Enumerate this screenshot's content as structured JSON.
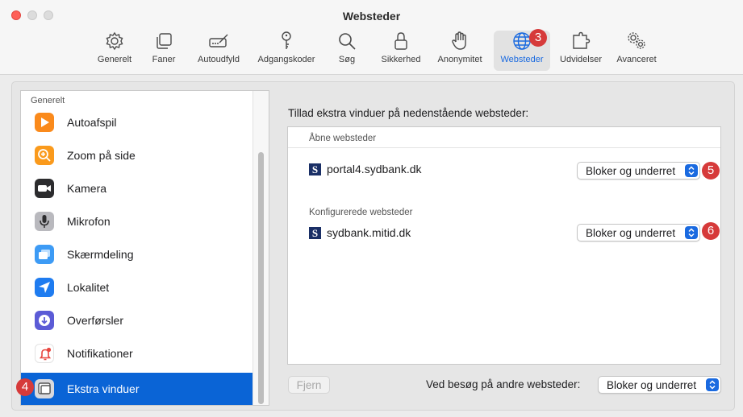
{
  "window": {
    "title": "Websteder"
  },
  "toolbar": {
    "items": [
      {
        "label": "Generelt",
        "icon": "gear-icon"
      },
      {
        "label": "Faner",
        "icon": "tabs-icon"
      },
      {
        "label": "Autoudfyld",
        "icon": "autofill-icon"
      },
      {
        "label": "Adgangskoder",
        "icon": "key-icon"
      },
      {
        "label": "Søg",
        "icon": "search-icon"
      },
      {
        "label": "Sikkerhed",
        "icon": "lock-icon"
      },
      {
        "label": "Anonymitet",
        "icon": "hand-icon"
      },
      {
        "label": "Websteder",
        "icon": "globe-icon",
        "active": true
      },
      {
        "label": "Udvidelser",
        "icon": "puzzle-icon"
      },
      {
        "label": "Avanceret",
        "icon": "gears-icon"
      }
    ]
  },
  "markers": {
    "websites_tab": "3",
    "sidebar_selected": "4",
    "row1_popup": "5",
    "row2_popup": "6"
  },
  "sidebar": {
    "group_label": "Generelt",
    "items": [
      {
        "label": "Autoafspil",
        "icon": "play-icon",
        "color": "#fa8a1c"
      },
      {
        "label": "Zoom på side",
        "icon": "zoom-icon",
        "color": "#fa9a1c"
      },
      {
        "label": "Kamera",
        "icon": "camera-icon",
        "color": "#2c2c2e"
      },
      {
        "label": "Mikrofon",
        "icon": "microphone-icon",
        "color": "#8e8e93"
      },
      {
        "label": "Skærmdeling",
        "icon": "screen-share-icon",
        "color": "#3d9bf5"
      },
      {
        "label": "Lokalitet",
        "icon": "location-icon",
        "color": "#1f7cf0"
      },
      {
        "label": "Overførsler",
        "icon": "download-icon",
        "color": "#5b5bd6"
      },
      {
        "label": "Notifikationer",
        "icon": "bell-icon",
        "color": "#e8463f"
      },
      {
        "label": "Ekstra vinduer",
        "icon": "windows-icon",
        "color": "#8e8e93",
        "selected": true
      }
    ]
  },
  "main": {
    "heading": "Tillad ekstra vinduer på nedenstående websteder:",
    "open_section": "Åbne websteder",
    "configured_section": "Konfigurerede websteder",
    "sites": [
      {
        "favicon": "S",
        "name": "portal4.sydbank.dk",
        "setting": "Bloker og underret"
      },
      {
        "favicon": "S",
        "name": "sydbank.mitid.dk",
        "setting": "Bloker og underret"
      }
    ],
    "remove_label": "Fjern",
    "other_sites_label": "Ved besøg på andre websteder:",
    "other_sites_setting": "Bloker og underret"
  },
  "colors": {
    "accent": "#0a64d6",
    "marker": "#d63a3a"
  }
}
